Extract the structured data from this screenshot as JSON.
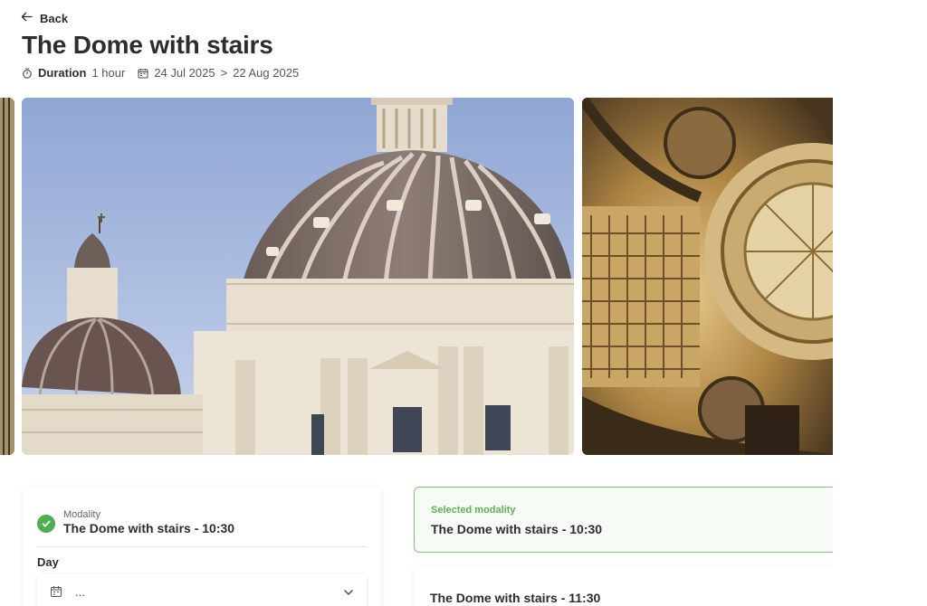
{
  "nav": {
    "back_label": "Back"
  },
  "tour": {
    "title": "The Dome with stairs",
    "duration_label": "Duration",
    "duration_value": "1 hour",
    "date_from": "24 Jul 2025",
    "date_sep": ">",
    "date_to": "22 Aug 2025"
  },
  "booking": {
    "modality_label": "Modality",
    "modality_value": "The Dome with stairs - 10:30",
    "day_label": "Day",
    "day_value": "..."
  },
  "options": {
    "selected_label": "Selected modality",
    "selected_value": "The Dome with stairs - 10:30",
    "items": [
      {
        "label": "The Dome with stairs - 11:30"
      }
    ]
  },
  "colors": {
    "accent_green": "#4caf50",
    "selected_border": "#7bc96f",
    "title_text": "#2d2d2d"
  },
  "icons": [
    "arrow-left-icon",
    "stopwatch-icon",
    "calendar-icon",
    "check-circle-icon",
    "chevron-down-icon"
  ]
}
